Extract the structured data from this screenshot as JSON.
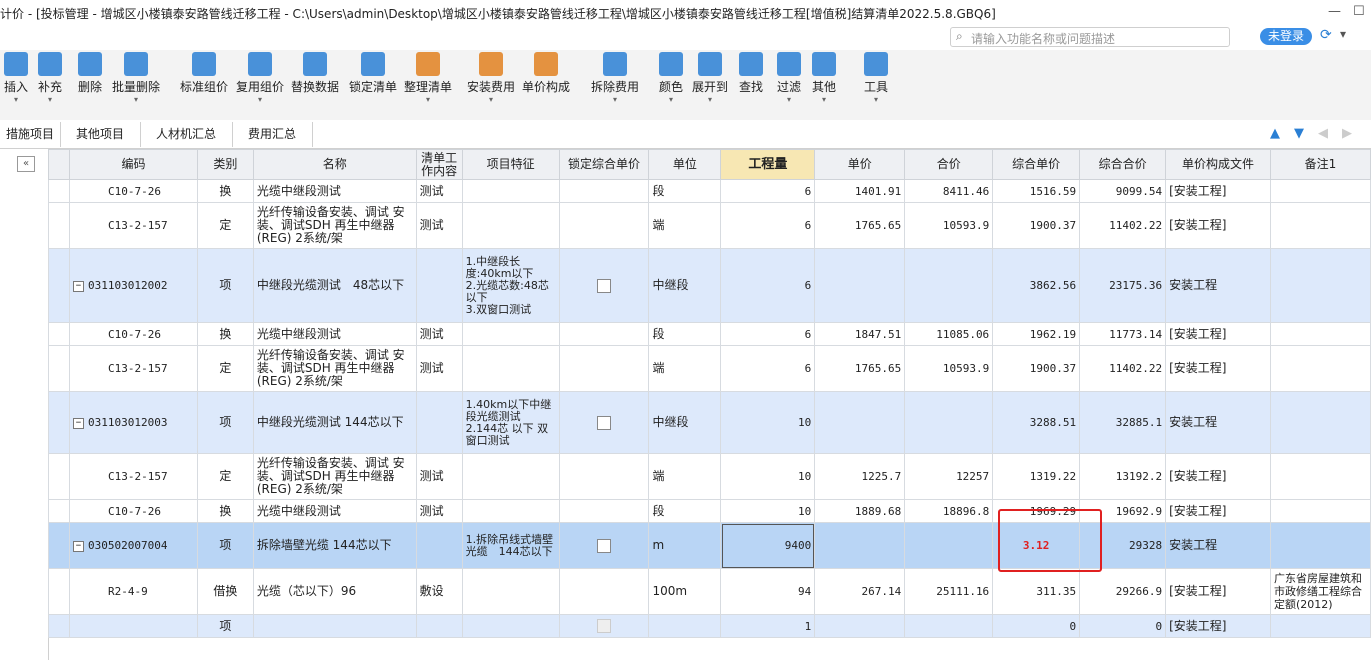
{
  "title": "计价 - [投标管理 - 增城区小楼镇泰安路管线迁移工程 - C:\\Users\\admin\\Desktop\\增城区小楼镇泰安路管线迁移工程\\增城区小楼镇泰安路管线迁移工程[增值税]结算清单2022.5.8.GBQ6]",
  "search_placeholder": "请输入功能名称或问题描述",
  "login_label": "未登录",
  "toolbar": [
    {
      "label": "插入",
      "icon": "insert-icon",
      "color": "#2a7fd4",
      "arrow": true
    },
    {
      "label": "补充",
      "icon": "supplement-icon",
      "color": "#2a7fd4",
      "arrow": true
    },
    {
      "label": "删除",
      "icon": "delete-icon",
      "color": "#2a7fd4",
      "arrow": false
    },
    {
      "label": "批量删除",
      "icon": "batch-delete-icon",
      "color": "#2a7fd4",
      "arrow": true
    },
    {
      "label": "标准组价",
      "icon": "standard-price-icon",
      "color": "#2a7fd4",
      "arrow": false
    },
    {
      "label": "复用组价",
      "icon": "reuse-price-icon",
      "color": "#2a7fd4",
      "arrow": true
    },
    {
      "label": "替换数据",
      "icon": "replace-data-icon",
      "color": "#2a7fd4",
      "arrow": false
    },
    {
      "label": "锁定清单",
      "icon": "lock-list-icon",
      "color": "#2a7fd4",
      "arrow": false
    },
    {
      "label": "整理清单",
      "icon": "organize-list-icon",
      "color": "#e08020",
      "arrow": true
    },
    {
      "label": "安装费用",
      "icon": "install-fee-icon",
      "color": "#e08020",
      "arrow": true
    },
    {
      "label": "单价构成",
      "icon": "unit-price-icon",
      "color": "#e08020",
      "arrow": false
    },
    {
      "label": "拆除费用",
      "icon": "demolish-fee-icon",
      "color": "#2a7fd4",
      "arrow": true
    },
    {
      "label": "颜色",
      "icon": "color-icon",
      "color": "#2a7fd4",
      "arrow": true
    },
    {
      "label": "展开到",
      "icon": "expand-icon",
      "color": "#2a7fd4",
      "arrow": true
    },
    {
      "label": "查找",
      "icon": "find-icon",
      "color": "#2a7fd4",
      "arrow": false
    },
    {
      "label": "过滤",
      "icon": "filter-icon",
      "color": "#2a7fd4",
      "arrow": true
    },
    {
      "label": "其他",
      "icon": "other-icon",
      "color": "#2a7fd4",
      "arrow": true
    },
    {
      "label": "工具",
      "icon": "tools-icon",
      "color": "#2a7fd4",
      "arrow": true
    }
  ],
  "tabs": [
    "措施项目",
    "其他项目",
    "人材机汇总",
    "费用汇总"
  ],
  "columns": [
    "",
    "编码",
    "类别",
    "名称",
    "清单工作内容",
    "项目特征",
    "锁定综合单价",
    "单位",
    "工程量",
    "单价",
    "合价",
    "综合单价",
    "综合合价",
    "单价构成文件",
    "备注1"
  ],
  "rows": [
    {
      "type": "sub",
      "idx": "",
      "code": "C10-7-26",
      "cat": "换",
      "name": "光缆中继段测试",
      "work": "测试",
      "feat": "",
      "lock": null,
      "unit": "段",
      "qty": "6",
      "price": "1401.91",
      "total": "8411.46",
      "cprice": "1516.59",
      "ctotal": "9099.54",
      "file": "[安装工程]",
      "note": ""
    },
    {
      "type": "sub",
      "idx": "",
      "code": "C13-2-157",
      "cat": "定",
      "name": "光纤传输设备安装、调试 安装、调试SDH 再生中继器(REG) 2系统/架",
      "work": "测试",
      "feat": "",
      "lock": null,
      "unit": "端",
      "qty": "6",
      "price": "1765.65",
      "total": "10593.9",
      "cprice": "1900.37",
      "ctotal": "11402.22",
      "file": "[安装工程]",
      "note": ""
    },
    {
      "type": "item",
      "idx": "9",
      "code": "031103012002",
      "cat": "项",
      "name": "中继段光缆测试　48芯以下",
      "work": "",
      "feat": "1.中继段长度:40km以下\n2.光缆芯数:48芯以下\n3.双窗口测试",
      "lock": false,
      "unit": "中继段",
      "qty": "6",
      "price": "",
      "total": "",
      "cprice": "3862.56",
      "ctotal": "23175.36",
      "file": "安装工程",
      "note": ""
    },
    {
      "type": "sub",
      "idx": "",
      "code": "C10-7-26",
      "cat": "换",
      "name": "光缆中继段测试",
      "work": "测试",
      "feat": "",
      "lock": null,
      "unit": "段",
      "qty": "6",
      "price": "1847.51",
      "total": "11085.06",
      "cprice": "1962.19",
      "ctotal": "11773.14",
      "file": "[安装工程]",
      "note": ""
    },
    {
      "type": "sub",
      "idx": "",
      "code": "C13-2-157",
      "cat": "定",
      "name": "光纤传输设备安装、调试 安装、调试SDH 再生中继器(REG) 2系统/架",
      "work": "测试",
      "feat": "",
      "lock": null,
      "unit": "端",
      "qty": "6",
      "price": "1765.65",
      "total": "10593.9",
      "cprice": "1900.37",
      "ctotal": "11402.22",
      "file": "[安装工程]",
      "note": ""
    },
    {
      "type": "item",
      "idx": "10",
      "code": "031103012003",
      "cat": "项",
      "name": "中继段光缆测试 144芯以下",
      "work": "",
      "feat": "1.40km以下中继段光缆测试\n2.144芯 以下 双窗口测试",
      "lock": false,
      "unit": "中继段",
      "qty": "10",
      "price": "",
      "total": "",
      "cprice": "3288.51",
      "ctotal": "32885.1",
      "file": "安装工程",
      "note": ""
    },
    {
      "type": "sub",
      "idx": "",
      "code": "C13-2-157",
      "cat": "定",
      "name": "光纤传输设备安装、调试 安装、调试SDH 再生中继器(REG) 2系统/架",
      "work": "测试",
      "feat": "",
      "lock": null,
      "unit": "端",
      "qty": "10",
      "price": "1225.7",
      "total": "12257",
      "cprice": "1319.22",
      "ctotal": "13192.2",
      "file": "[安装工程]",
      "note": ""
    },
    {
      "type": "sub",
      "idx": "",
      "code": "C10-7-26",
      "cat": "换",
      "name": "光缆中继段测试",
      "work": "测试",
      "feat": "",
      "lock": null,
      "unit": "段",
      "qty": "10",
      "price": "1889.68",
      "total": "18896.8",
      "cprice": "1969.29",
      "ctotal": "19692.9",
      "file": "[安装工程]",
      "note": ""
    },
    {
      "type": "sel",
      "idx": "11",
      "code": "030502007004",
      "cat": "项",
      "name": "拆除墙壁光缆 144芯以下",
      "work": "",
      "feat": "1.拆除吊线式墙壁光缆　144芯以下",
      "lock": false,
      "unit": "m",
      "qty": "9400",
      "price": "",
      "total": "",
      "cprice": "3.12",
      "ctotal": "29328",
      "file": "安装工程",
      "note": ""
    },
    {
      "type": "sub",
      "idx": "",
      "code": "R2-4-9",
      "cat": "借换",
      "name": "光缆（芯以下）96",
      "work": "敷设",
      "feat": "",
      "lock": null,
      "unit": "100m",
      "qty": "94",
      "price": "267.14",
      "total": "25111.16",
      "cprice": "311.35",
      "ctotal": "29266.9",
      "file": "[安装工程]",
      "note": "广东省房屋建筑和市政修缮工程综合定额(2012)"
    },
    {
      "type": "item",
      "idx": "12",
      "code": "",
      "cat": "项",
      "name": "",
      "work": "",
      "feat": "",
      "lock": "disabled",
      "unit": "",
      "qty": "1",
      "price": "",
      "total": "",
      "cprice": "0",
      "ctotal": "0",
      "file": "[安装工程]",
      "note": ""
    }
  ]
}
